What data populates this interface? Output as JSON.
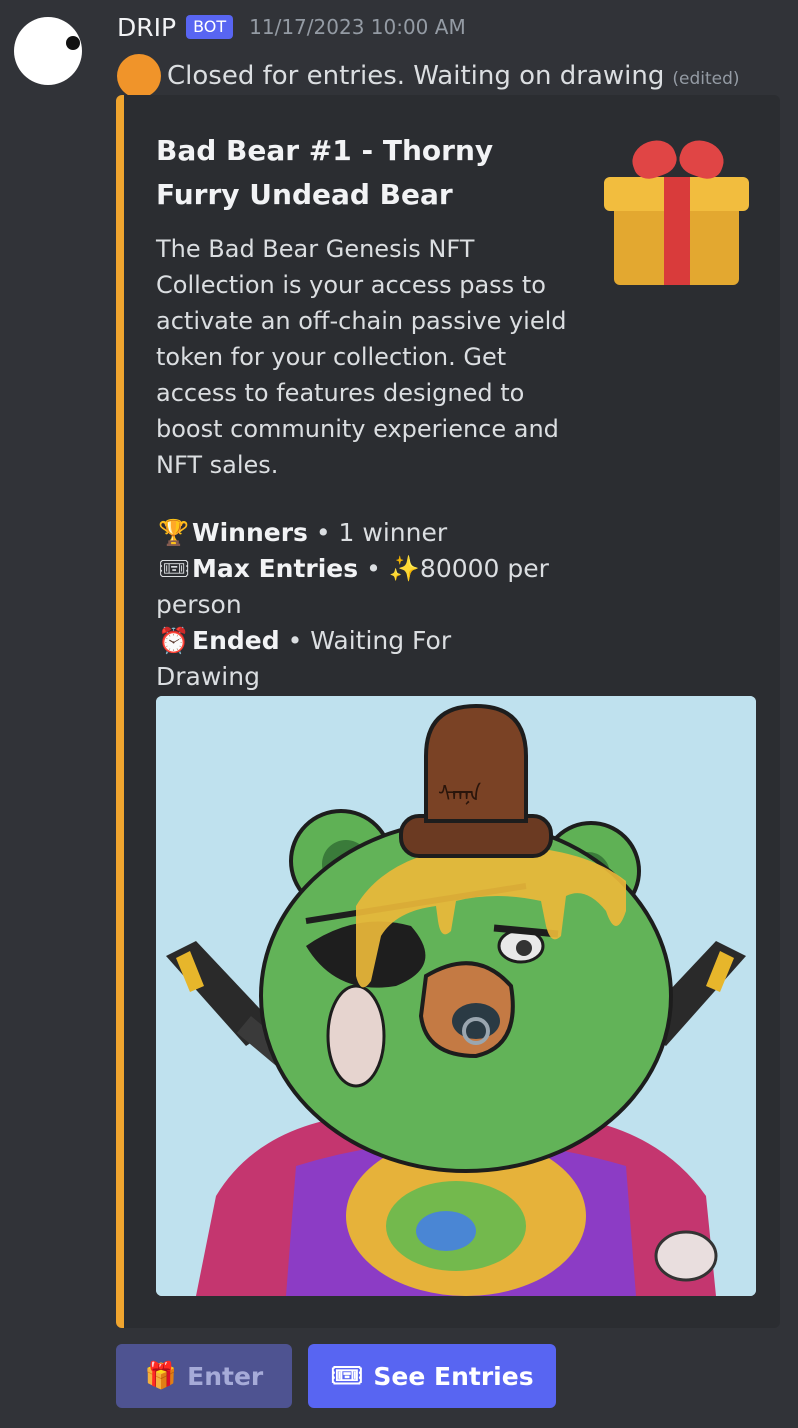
{
  "message": {
    "username": "DRIP",
    "bot_tag": "BOT",
    "timestamp": "11/17/2023 10:00 AM",
    "status_text": "Closed for entries. Waiting on drawing",
    "edited_label": "(edited)"
  },
  "embed": {
    "accent_color": "#f0a52f",
    "title": "Bad Bear #1 - Thorny Furry Undead Bear",
    "description": "The Bad Bear Genesis NFT Collection is your access pass to activate an off-chain passive yield token for your collection. Get access to features designed to boost community experience and NFT sales.",
    "fields": [
      {
        "icon": "trophy-icon",
        "glyph": "🏆",
        "label": "Winners",
        "separator": " • ",
        "value": "1 winner"
      },
      {
        "icon": "ticket-icon",
        "glyph": "🎟",
        "label": "Max Entries",
        "separator": " • ",
        "value": "✨80000 per person"
      },
      {
        "icon": "alarm-clock-icon",
        "glyph": "⏰",
        "label": "Ended",
        "separator": " • ",
        "value": "Waiting For Drawing"
      }
    ]
  },
  "buttons": {
    "enter_label": "Enter",
    "enter_icon": "🎁",
    "see_entries_label": "See Entries",
    "see_entries_icon": "🎟"
  }
}
